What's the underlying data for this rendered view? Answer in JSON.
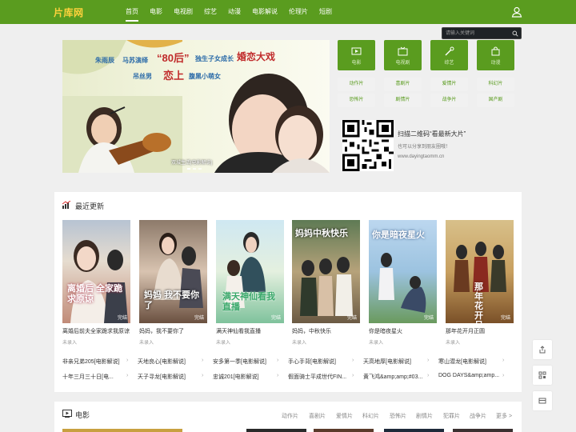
{
  "header": {
    "logo": "片库网",
    "nav": [
      "首页",
      "电影",
      "电视剧",
      "综艺",
      "动漫",
      "电影解说",
      "伦理片",
      "短剧"
    ],
    "active_index": 0
  },
  "search": {
    "placeholder": "请输入关键词"
  },
  "banner": {
    "lines": [
      "朱雨辰",
      "马苏演绎",
      "“80后”",
      "独生子女成长",
      "婚恋大戏",
      "吊丝男",
      "恋上",
      "腹黑小萌女"
    ],
    "caption": "双城生活[电影解说]"
  },
  "categories": [
    {
      "label": "电影",
      "icon": "film-icon"
    },
    {
      "label": "电视剧",
      "icon": "tv-icon"
    },
    {
      "label": "综艺",
      "icon": "wand-icon"
    },
    {
      "label": "动漫",
      "icon": "bag-icon"
    }
  ],
  "genres": [
    "动作片",
    "喜剧片",
    "爱情片",
    "科幻片",
    "恐怖片",
    "剧情片",
    "战争片",
    "国产剧"
  ],
  "qr": {
    "title": "扫描二维码“看最新大片”",
    "subtitle": "也可以分享到朋友圈哦！",
    "url": "www.dayingtaomm.cn"
  },
  "recent": {
    "title": "最近更新",
    "items": [
      {
        "name": "离婚后前夫全家跪求我原谅",
        "cast": "未录入",
        "tag": "完结",
        "poster_text": "离婚后 全家跪求原谅"
      },
      {
        "name": "妈妈，我不要你了",
        "cast": "未录入",
        "tag": "完结",
        "poster_text": "妈妈 我不要你了"
      },
      {
        "name": "满天神仙看我直播",
        "cast": "未录入",
        "tag": "完结",
        "poster_text": "满天神仙看我直播"
      },
      {
        "name": "妈妈，中秋快乐",
        "cast": "未录入",
        "tag": "完结",
        "poster_text": "妈妈中秋快乐"
      },
      {
        "name": "你是暗夜星火",
        "cast": "未录入",
        "tag": "完结",
        "poster_text": "你是暗夜星火"
      },
      {
        "name": "那年花开月正圆",
        "cast": "未录入",
        "tag": "完结",
        "poster_text": "那年花开月正圆"
      }
    ],
    "links_row1": [
      "非亲兄弟205[电影解说]",
      "天地良心[电影解说]",
      "安多第一季[电影解说]",
      "手心手背[电影解说]",
      "天高地厚[电影解说]",
      "寒山潜龙[电影解说]"
    ],
    "links_row2": [
      "十年三月三十日[电...",
      "天子寻龙[电影解说]",
      "忠诚201[电影解说]",
      "假面骑士平成世代FIN...",
      "黄飞鸿&amp;amp;#03...",
      "DOG DAYS&amp;amp..."
    ]
  },
  "movies": {
    "title": "电影",
    "tabs": [
      "动作片",
      "喜剧片",
      "爱情片",
      "科幻片",
      "恐怖片",
      "剧情片",
      "犯罪片",
      "战争片",
      "更多 >"
    ]
  },
  "side": {
    "buttons": [
      "share-icon",
      "grid-icon",
      "card-icon"
    ]
  },
  "colors": {
    "brand": "#5a9c1f",
    "logo": "#ffd23c",
    "accent_text": "#b52735"
  }
}
